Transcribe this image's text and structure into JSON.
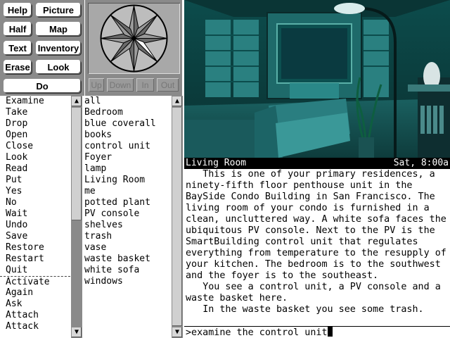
{
  "buttons": {
    "help": "Help",
    "picture": "Picture",
    "half": "Half",
    "map": "Map",
    "text": "Text",
    "inventory": "Inventory",
    "erase": "Erase",
    "look": "Look",
    "do": "Do"
  },
  "directions": {
    "up": "Up",
    "down": "Down",
    "in": "In",
    "out": "Out"
  },
  "status": {
    "room": "Living Room",
    "time": "Sat, 8:00a"
  },
  "verbs": [
    "Examine",
    "Take",
    "Drop",
    "Open",
    "Close",
    "Look",
    "Read",
    "Put",
    "Yes",
    "No",
    "Wait",
    "Undo",
    "Save",
    "Restore",
    "Restart",
    "Quit",
    "Activate",
    "Again",
    "Ask",
    "Attach",
    "Attack"
  ],
  "objects": [
    "all",
    "Bedroom",
    "blue coverall",
    "books",
    "control unit",
    "Foyer",
    "lamp",
    "Living Room",
    "me",
    "potted plant",
    "PV console",
    "shelves",
    "trash",
    "vase",
    "waste basket",
    "white sofa",
    "windows"
  ],
  "text": {
    "lines": [
      "   This is one of your primary residences, a",
      "ninety-fifth floor penthouse unit in the",
      "BaySide Condo Building in San Francisco. The",
      "living room of your condo is furnished in a",
      "clean, uncluttered way. A white sofa faces the",
      "ubiquitous PV console. Next to the PV is the",
      "SmartBuilding control unit that regulates",
      "everything from temperature to the resupply of",
      "your kitchen. The bedroom is to the southwest",
      "and the foyer is to the southeast.",
      "   You see a control unit, a PV console and a",
      "waste basket here.",
      "   In the waste basket you see some trash."
    ],
    "command": ">examine the control unit"
  },
  "colors": {
    "panel_gray": "#8a8a8a",
    "picture_teal": "#0a3a3a"
  },
  "icons": {
    "compass": "compass-rose-icon",
    "scroll_up": "up-arrow-icon",
    "scroll_down": "down-arrow-icon"
  }
}
